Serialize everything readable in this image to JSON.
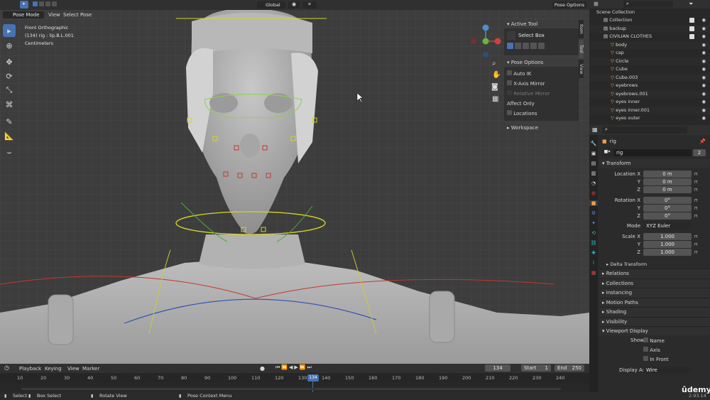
{
  "viewport": {
    "mode": "Pose Mode",
    "menus": [
      "View",
      "Select",
      "Pose"
    ],
    "orientation": "Global",
    "pose_options": "Pose Options",
    "overlay_lines": [
      "Front Orthographic",
      "(134) rig : lip.B.L.001",
      "Centimeters"
    ]
  },
  "npanel": {
    "tabs": [
      "Item",
      "Tool",
      "View"
    ],
    "active_tool_header": "Active Tool",
    "select_box": "Select Box",
    "pose_options_header": "Pose Options",
    "auto_ik": "Auto IK",
    "x_axis_mirror": "X-Axis Mirror",
    "relative_mirror": "Relative Mirror",
    "affect_only": "Affect Only",
    "locations": "Locations",
    "workspace": "Workspace"
  },
  "outliner": {
    "root": "Scene Collection",
    "items": [
      {
        "label": "Collection",
        "indent": 1
      },
      {
        "label": "backup",
        "indent": 1
      },
      {
        "label": "CIVILIAN CLOTHES",
        "indent": 1
      },
      {
        "label": "body",
        "indent": 2
      },
      {
        "label": "cap",
        "indent": 2
      },
      {
        "label": "Circle",
        "indent": 2
      },
      {
        "label": "Cube",
        "indent": 2
      },
      {
        "label": "Cube.003",
        "indent": 2
      },
      {
        "label": "eyebrows",
        "indent": 2
      },
      {
        "label": "eyebrows.001",
        "indent": 2
      },
      {
        "label": "eyes inner",
        "indent": 2
      },
      {
        "label": "eyes inner.001",
        "indent": 2
      },
      {
        "label": "eyes outer",
        "indent": 2
      }
    ]
  },
  "properties": {
    "object_name": "rig",
    "data_name": "rig",
    "users": "2",
    "transform_header": "Transform",
    "location_x_label": "Location X",
    "y_label": "Y",
    "z_label": "Z",
    "location": [
      "0 m",
      "0 m",
      "0 m"
    ],
    "rotation_x_label": "Rotation X",
    "rotation": [
      "0°",
      "0°",
      "0°"
    ],
    "mode_label": "Mode",
    "rotation_mode": "XYZ Euler",
    "scale_x_label": "Scale X",
    "scale": [
      "1.000",
      "1.000",
      "1.000"
    ],
    "delta_transform": "Delta Transform",
    "sections": [
      "Relations",
      "Collections",
      "Instancing",
      "Motion Paths",
      "Shading",
      "Visibility"
    ],
    "viewport_display": "Viewport Display",
    "show_label": "Show",
    "show_name": "Name",
    "show_axis": "Axis",
    "show_in_front": "In Front",
    "display_as_label": "Display As",
    "display_as": "Wire"
  },
  "timeline": {
    "menus": [
      "Playback",
      "Keying",
      "View",
      "Marker"
    ],
    "current_frame": "134",
    "start_label": "Start",
    "start": "1",
    "end_label": "End",
    "end": "250",
    "ticks": [
      "10",
      "20",
      "30",
      "40",
      "50",
      "60",
      "70",
      "80",
      "90",
      "100",
      "110",
      "120",
      "130",
      "140",
      "150",
      "160",
      "170",
      "180",
      "190",
      "200",
      "210",
      "220",
      "230",
      "240"
    ],
    "playhead": "134"
  },
  "statusbar": {
    "items": [
      "Select",
      "Box Select",
      "Rotate View",
      "Pose Context Menu"
    ],
    "version": "2.93.14"
  },
  "watermark": "ûdemy"
}
